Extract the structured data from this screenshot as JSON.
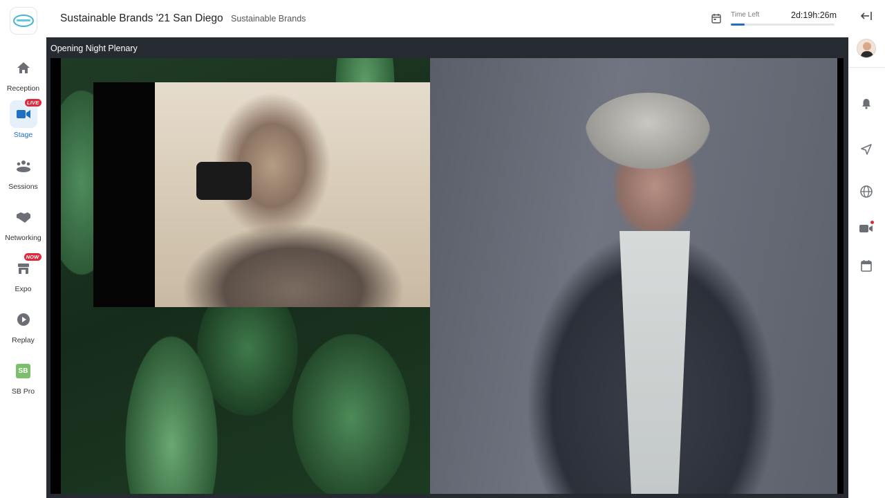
{
  "sidebar": {
    "logo_icon": "event-logo-icon",
    "items": [
      {
        "label": "Reception",
        "icon": "home-icon",
        "badge": ""
      },
      {
        "label": "Stage",
        "icon": "video-camera-icon",
        "badge": "LIVE"
      },
      {
        "label": "Sessions",
        "icon": "people-group-icon",
        "badge": ""
      },
      {
        "label": "Networking",
        "icon": "handshake-icon",
        "badge": ""
      },
      {
        "label": "Expo",
        "icon": "booth-icon",
        "badge": "NOW"
      },
      {
        "label": "Replay",
        "icon": "play-circle-icon",
        "badge": ""
      },
      {
        "label": "SB Pro",
        "icon": "sb-pro-icon",
        "badge": ""
      }
    ],
    "sb_pro_text": "SB"
  },
  "header": {
    "event_title": "Sustainable Brands '21 San Diego",
    "organizer": "Sustainable Brands",
    "time_left_label": "Time Left",
    "time_left_value": "2d:19h:26m",
    "time_progress": 0.13
  },
  "stage": {
    "title": "Opening Night Plenary"
  },
  "right_rail": {
    "icons": [
      "collapse-panel-icon",
      "user-avatar",
      "bell-icon",
      "send-icon",
      "globe-icon",
      "video-notification-icon",
      "calendar-icon"
    ]
  },
  "colors": {
    "accent": "#1f6fc4",
    "active_bg": "#e6f0fb",
    "badge_red": "#e0283b",
    "stage_bg": "#262a31"
  }
}
